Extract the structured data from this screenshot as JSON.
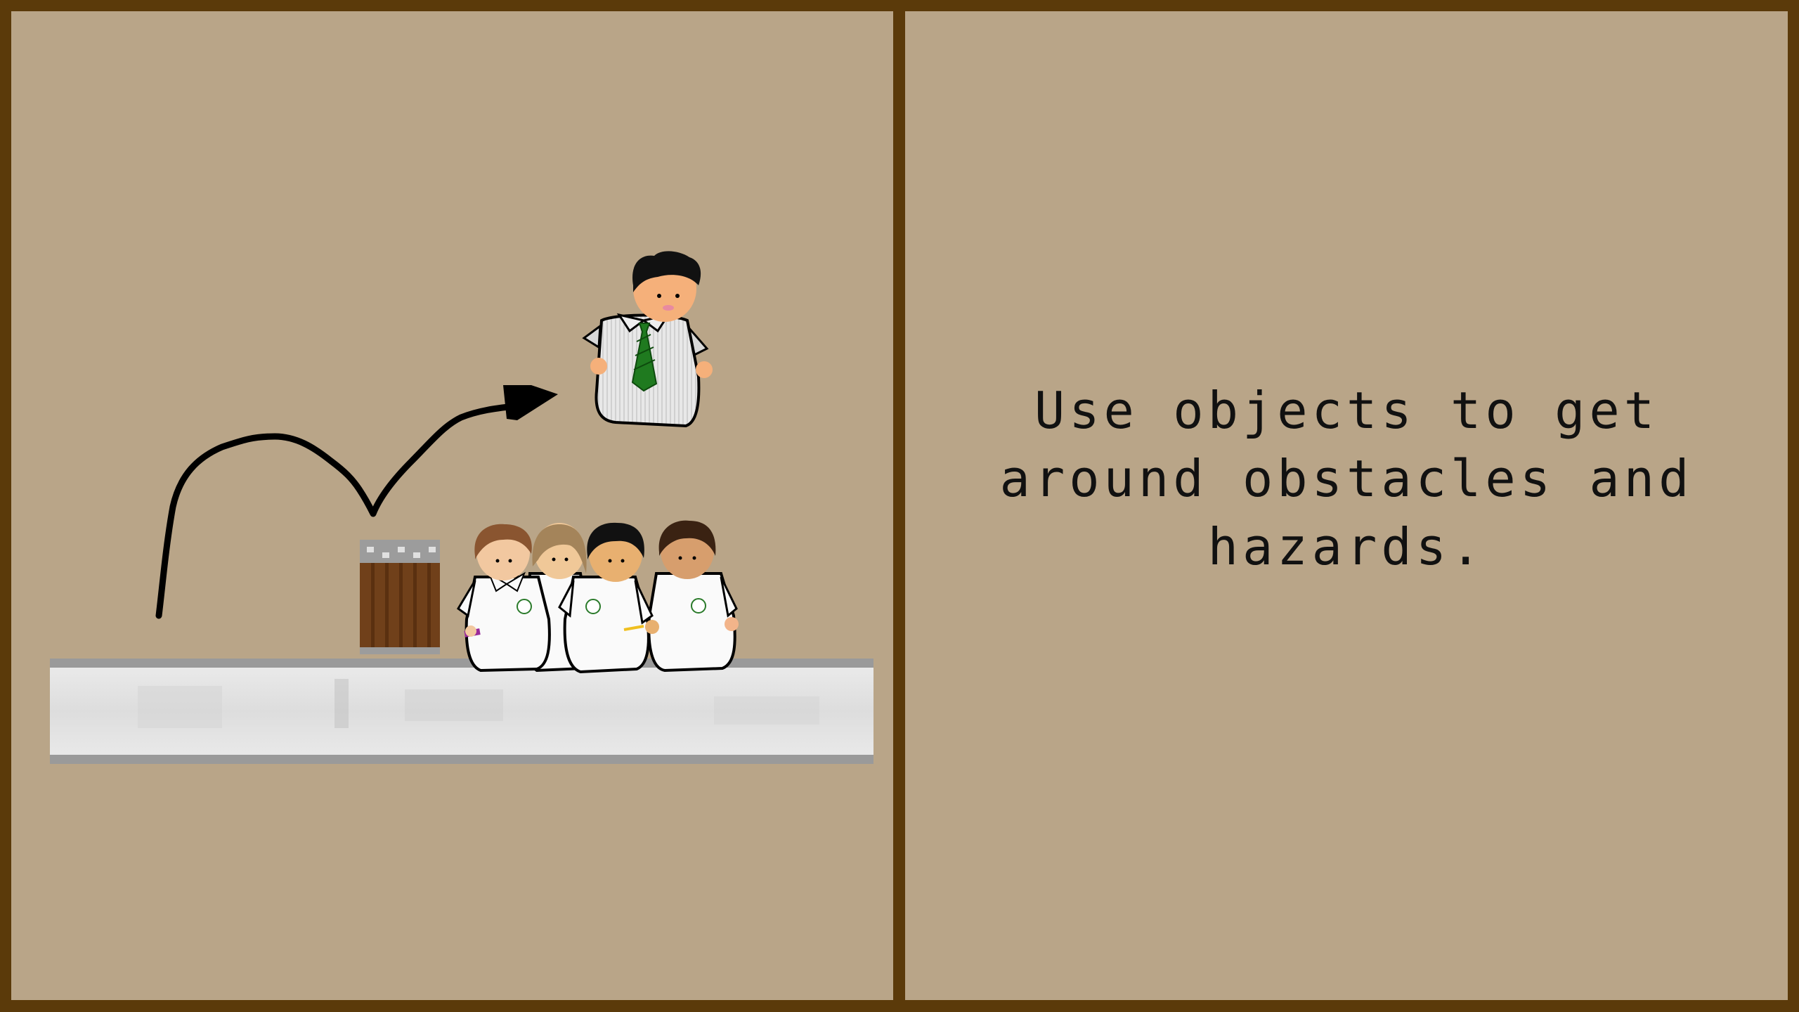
{
  "tutorial": {
    "tip_text": "Use objects to get\naround obstacles and\nhazards."
  },
  "scene": {
    "background_color": "#b9a588",
    "frame_color": "#5b3a0a",
    "characters": [
      {
        "name": "jumping-student-with-tie"
      },
      {
        "name": "student-brown-hair"
      },
      {
        "name": "student-blonde-hair"
      },
      {
        "name": "student-black-hair"
      },
      {
        "name": "student-dark-brown-hair"
      }
    ],
    "objects": [
      {
        "name": "trash-can"
      },
      {
        "name": "floor-platform"
      },
      {
        "name": "jump-path-arrow"
      }
    ]
  }
}
